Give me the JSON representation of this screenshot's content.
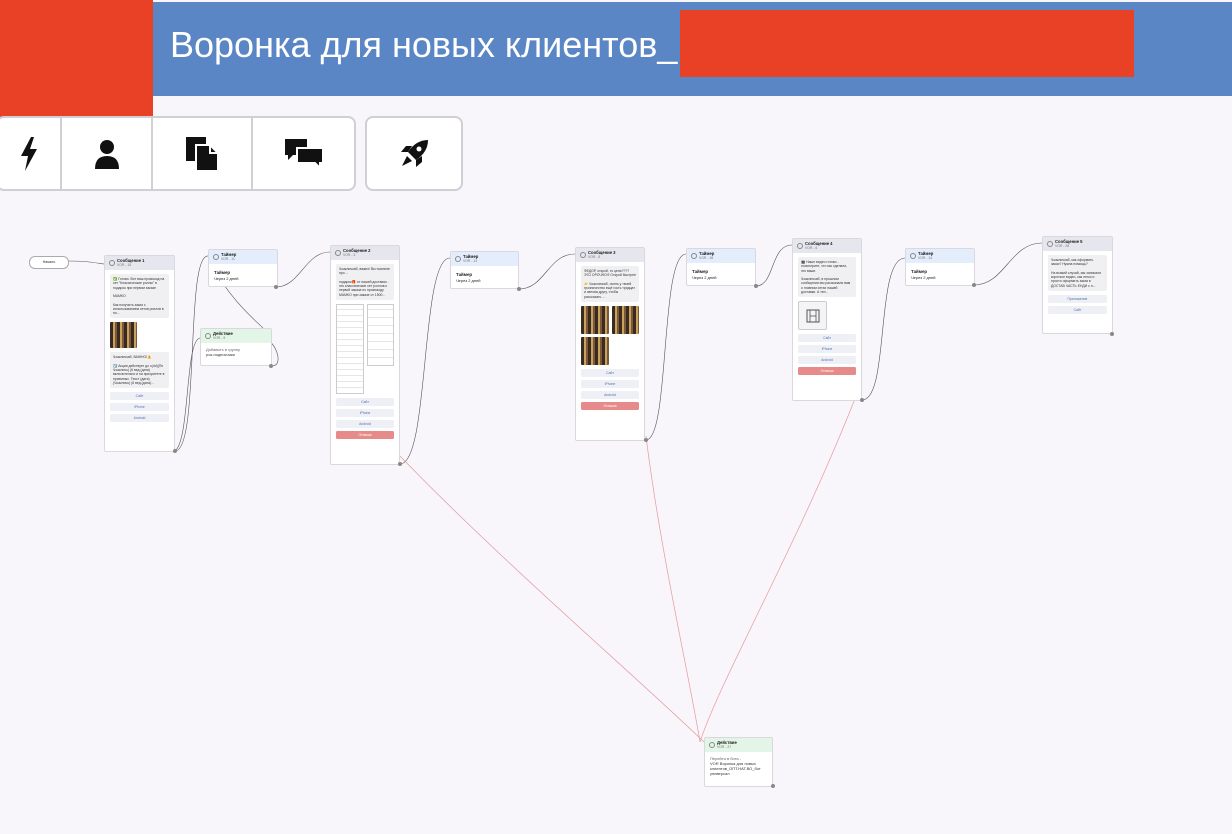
{
  "header": {
    "title": "Воронка для новых клиентов_"
  },
  "toolbar": {
    "icons": [
      "lightning-icon",
      "user-icon",
      "document-icon",
      "chat-icon",
      "rocket-icon"
    ]
  },
  "start": {
    "label": "Начало"
  },
  "nodes": {
    "msg1": {
      "title": "Сообщение 1",
      "sub": "VOR - 15",
      "b1": "✅ Готово. Вот ваш промокод на сет \"Классические роллы\" в подарок при первом заказе",
      "b1b": "MAMKO",
      "b2": "Как получить заказ с использованием сетов роллов в по...",
      "b3": "Чоакличкаб, ВАЖНО!⚠️",
      "b4": "☑️ Акция действует до с(dd)(Пн Чоакличь) (6 вед.(дата) включительно и на приоритете в приемных. Текст (дата)(Чоакличь) (6 вед.(дата)...",
      "btns": [
        "Сайт",
        "iPhone",
        "Android"
      ]
    },
    "timer1": {
      "title": "Таймер",
      "sub": "VOR - 11",
      "label": "Таймер",
      "body": "Через 2 дней"
    },
    "action1": {
      "title": "Действие",
      "sub": "VOR - 9",
      "body1": "Добавить в группу",
      "body2": "рок-подписчики"
    },
    "msg2": {
      "title": "Сообщение 2",
      "sub": "VOR - 3",
      "b1": "Чоакличкаб, важно! Вы помните про ...",
      "b2": "подарок🎁 от нашей доставки - это классические сет роллов к первой заказа по промокоду MAMKO при заказе от 1500...",
      "btns": [
        "Сайт",
        "iPhone",
        "Android",
        "Отписка"
      ]
    },
    "timer2": {
      "title": "Таймер",
      "sub": "VOR - 13",
      "label": "Таймер",
      "body": "Через 2 дней"
    },
    "msg3": {
      "title": "Сообщение 3",
      "sub": "VOR - 8",
      "b1": "ФЕДОР, открой, то цена???? ЭТО ОРОЧНО!!! Открой быстрее",
      "b2": "👉 Чоакличкаб, очень у твоей грозничество ещё гость тридцат и свеова другу, чтобы рассказать ...",
      "btns": [
        "Сайт",
        "iPhone",
        "Android",
        "Отписка"
      ]
    },
    "timer3": {
      "title": "Таймер",
      "sub": "VOR - 18",
      "label": "Таймер",
      "body": "Через 2 дней"
    },
    "msg4": {
      "title": "Сообщение 4",
      "sub": "VOR - 6",
      "b1": "🎬 Наше видео готово - посмотрите, что мы сделали, это ваше.",
      "b2": "Чоакличкаб, в прошлом сообщении мы рассказали вам о главном сетах нашей доставки. А теп...",
      "btns": [
        "Сайт",
        "iPhone",
        "Android",
        "Отписка"
      ]
    },
    "timer4": {
      "title": "Таймер",
      "sub": "VOR - 14",
      "label": "Таймер",
      "body": "Через 2 дней"
    },
    "msg5": {
      "title": "Сообщение 5",
      "sub": "VOR - 28",
      "b1": "Чоакличкаб, как оформить заказ? Нужна помощь?",
      "b2": "На всякий случай, мы записали короткое видео, как легко и просто оформить заказ в ДОСТАВ ЧАСТЬ ЕНДИ с п...",
      "btns": [
        "Приложение",
        "Сайт"
      ]
    },
    "action2": {
      "title": "Действие",
      "sub": "VOR - 27",
      "body1": "Перейти в бота -",
      "body2": "VOR Воронка для новых клиентов_ОПТ.НАТ.ВО_бот универсал"
    }
  }
}
